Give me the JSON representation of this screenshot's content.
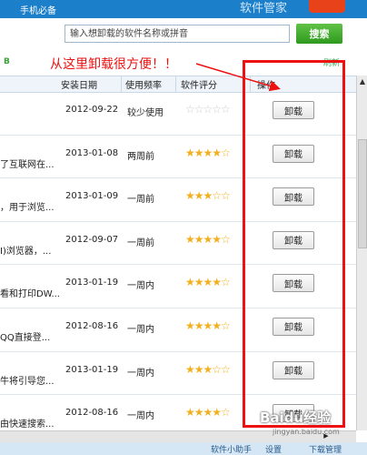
{
  "titlebar": {
    "tab_label": "手机必备",
    "brand": "软件管家"
  },
  "search": {
    "placeholder": "输入想卸载的软件名称或拼音",
    "button_label": "搜索"
  },
  "toolbar": {
    "left_char": "B",
    "refresh_label": "刷新"
  },
  "annotation": "从这里卸载很方便！！",
  "columns": {
    "date": "安装日期",
    "freq": "使用频率",
    "rating": "软件评分",
    "action": "操作"
  },
  "rows": [
    {
      "name": "",
      "date": "2012-09-22",
      "freq": "较少使用",
      "stars": "☆☆☆☆☆",
      "action": "卸载"
    },
    {
      "name": "了互联网在...",
      "date": "2013-01-08",
      "freq": "两周前",
      "stars": "★★★★☆",
      "action": "卸载"
    },
    {
      "name": "，用于浏览...",
      "date": "2013-01-09",
      "freq": "一周前",
      "stars": "★★★☆☆",
      "action": "卸载"
    },
    {
      "name": "I)浏览器，...",
      "date": "2012-09-07",
      "freq": "一周前",
      "stars": "★★★★☆",
      "action": "卸载"
    },
    {
      "name": "看和打印DW...",
      "date": "2013-01-19",
      "freq": "一周内",
      "stars": "★★★★☆",
      "action": "卸载"
    },
    {
      "name": "QQ直接登...",
      "date": "2012-08-16",
      "freq": "一周内",
      "stars": "★★★★☆",
      "action": "卸载"
    },
    {
      "name": "牛将引导您...",
      "date": "2013-01-19",
      "freq": "一周内",
      "stars": "★★★☆☆",
      "action": "卸载"
    },
    {
      "name": "由快速搜索...",
      "date": "2012-08-16",
      "freq": "一周内",
      "stars": "★★★★☆",
      "action": "卸载"
    }
  ],
  "statusbar": {
    "helper": "软件小助手",
    "settings": "设置",
    "downloads": "下载管理"
  },
  "watermark": {
    "main": "Baidu经验",
    "sub": "jingyan.baidu.com"
  },
  "colors": {
    "accent": "#1b7fc9",
    "annotation": "#ee1111",
    "search_button": "#3aa52a",
    "star": "#f2b01e"
  }
}
